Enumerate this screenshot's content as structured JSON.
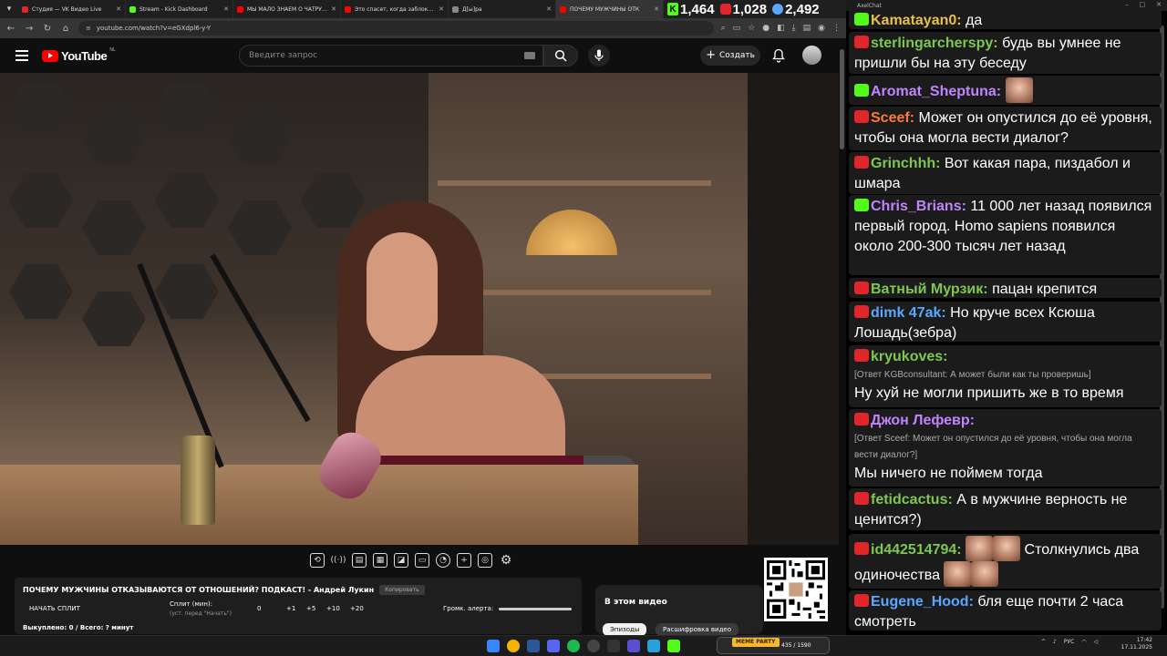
{
  "browser": {
    "tabs": [
      {
        "label": "Студия — VK Видео Live",
        "color": "#e0262b",
        "active": false
      },
      {
        "label": "Stream - Kick Dashboard",
        "color": "#53fc18",
        "active": false
      },
      {
        "label": "МЫ МАЛО ЗНАЕМ О ЧАТРУЛЕ",
        "color": "#ff0000",
        "active": false
      },
      {
        "label": "Это спасет, когда заблокиру",
        "color": "#ff0000",
        "active": false
      },
      {
        "label": "Д[ы]ра",
        "color": "#888888",
        "active": false
      },
      {
        "label": "ПОЧЕМУ МУЖЧИНЫ ОТК",
        "color": "#ff0000",
        "active": true
      }
    ],
    "url": "youtube.com/watch?v=eGXdpl6-y-Y"
  },
  "stream_stats": {
    "kick_viewers": "1,464",
    "vk_viewers": "1,028",
    "total_viewers": "2,492"
  },
  "youtube": {
    "logo_text": "YouTube",
    "logo_region": "NL",
    "search_placeholder": "Введите запрос",
    "create_label": "Создать",
    "colors": {
      "brand": "#ff0000",
      "background": "#0f0f0f"
    }
  },
  "split_overlay": {
    "title": "ПОЧЕМУ МУЖЧИНЫ ОТКАЗЫВАЮТСЯ ОТ ОТНОШЕНИЙ? ПОДКАСТ! - Андрей Лукин",
    "copy_label": "Копировать",
    "start_label": "НАЧАТЬ СПЛИТ",
    "split_label": "Сплит (мин):",
    "split_hint": "(уст. перед \"Начать\")",
    "split_value": "0",
    "increments": [
      "+1",
      "+5",
      "+10",
      "+20"
    ],
    "alert_label": "Громк. алерта:",
    "alert_volume": 1.0,
    "bought_text": "Выкуплено: 0 / Всего: ? минут"
  },
  "in_this_video": {
    "heading": "В этом видео",
    "chips": [
      "Эпизоды",
      "Расшифровка видео"
    ]
  },
  "chat": {
    "window_title": "AxelChat",
    "messages": [
      {
        "platform": "kick",
        "user": "Kamatayan0:",
        "color": "#e8c14c",
        "text": "да"
      },
      {
        "platform": "vk",
        "user": "sterlingarcherspy:",
        "color": "#7ec850",
        "text": "будь вы умнее не пришли бы на эту беседу"
      },
      {
        "platform": "kick",
        "user": "Aromat_Sheptuna:",
        "color": "#c084fc",
        "text": "",
        "emote": "face-emote"
      },
      {
        "platform": "vk",
        "user": "Sceef:",
        "color": "#ff7a3c",
        "text": "Может он опустился до её уровня, чтобы она могла вести диалог?"
      },
      {
        "platform": "vk",
        "user": "Grinchhh:",
        "color": "#7ec850",
        "text": "Вот какая пара, пиздабол и шмара"
      },
      {
        "platform": "kick",
        "user": "Chris_Brians:",
        "color": "#c084fc",
        "text": "11 000 лет назад появился первый город. Homo sapiens появился около 200-300 тысяч лет назад"
      },
      {
        "platform": "vk",
        "user": "Ватный Мурзик:",
        "color": "#7ec850",
        "text": "пацан крепится"
      },
      {
        "platform": "vk",
        "user": "dimk 47ak:",
        "color": "#5aa7ff",
        "text": "Но круче всех Ксюша Лошадь(зебра)"
      },
      {
        "platform": "vk",
        "user": "kryukoves:",
        "color": "#7ec850",
        "reply": "[Ответ KGBconsultant: А может были как ты проверишь]",
        "text": "Ну хуй не могли пришить же в то время"
      },
      {
        "platform": "vk",
        "user": "Джон Лефевр:",
        "color": "#c084fc",
        "reply": "[Ответ Sceef: Может он опустился до её уровня, чтобы она могла вести диалог?]",
        "text": "Мы ничего не поймем тогда"
      },
      {
        "platform": "vk",
        "user": "fetidcactus:",
        "color": "#7ec850",
        "text": "А в мужчине верность не ценится?)"
      },
      {
        "platform": "vk",
        "user": "id442514794:",
        "color": "#7ec850",
        "text_a": "Столкнулись два",
        "text_b": "одиночества"
      },
      {
        "platform": "vk",
        "user": "Eugene_Hood:",
        "color": "#5aa7ff",
        "text": "бля еще почти 2 часа смотреть"
      }
    ]
  },
  "taskbar": {
    "meme_label": "MEME PARTY",
    "meme_counter": "435 / 1590",
    "lang": "РУС",
    "time": "17:42",
    "date": "17.11.2025"
  }
}
